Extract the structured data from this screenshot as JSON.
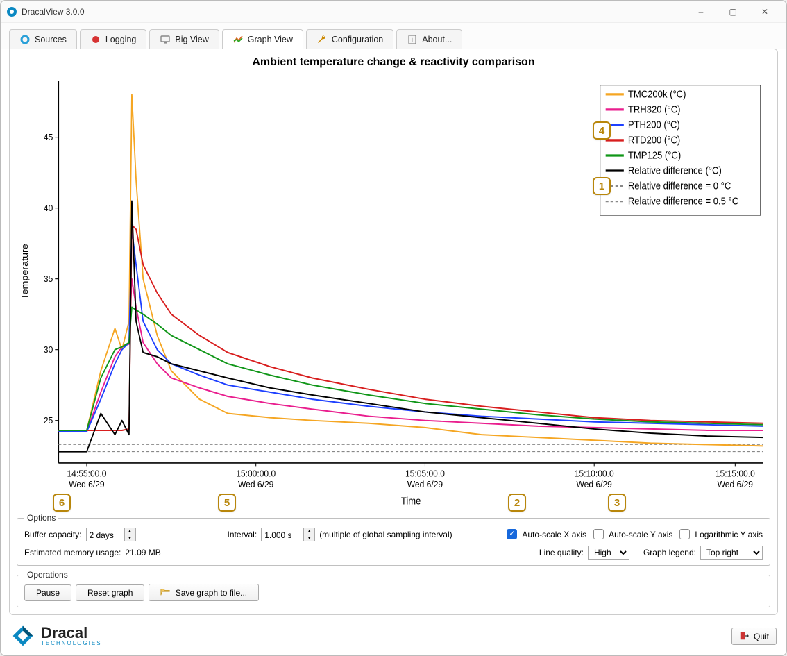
{
  "window": {
    "title": "DracalView 3.0.0"
  },
  "tabs": [
    {
      "label": "Sources"
    },
    {
      "label": "Logging"
    },
    {
      "label": "Big View"
    },
    {
      "label": "Graph View"
    },
    {
      "label": "Configuration"
    },
    {
      "label": "About..."
    }
  ],
  "chart_data": {
    "type": "line",
    "title": "Ambient temperature change & reactivity comparison",
    "xlabel": "Time",
    "ylabel": "Temperature",
    "ylim": [
      22,
      49
    ],
    "categories": [
      "14:55:00.0",
      "15:00:00.0",
      "15:05:00.0",
      "15:10:00.0",
      "15:15:00.0"
    ],
    "x_sublabel": "Wed 6/29",
    "x": [
      0,
      2,
      3,
      4,
      4.5,
      5,
      5.2,
      5.5,
      6,
      7,
      8,
      10,
      12,
      15,
      18,
      22,
      26,
      30,
      34,
      38,
      42,
      46,
      50
    ],
    "series": [
      {
        "name": "TMC200k (°C)",
        "color": "#f5a623",
        "values": [
          24.3,
          24.3,
          28.5,
          31.5,
          30.0,
          32.0,
          48.0,
          42.0,
          35.0,
          31.0,
          28.5,
          26.5,
          25.5,
          25.2,
          25.0,
          24.8,
          24.5,
          24.0,
          23.8,
          23.6,
          23.4,
          23.3,
          23.2
        ]
      },
      {
        "name": "TRH320 (°C)",
        "color": "#e91e8e",
        "values": [
          24.2,
          24.2,
          27.0,
          29.5,
          30.2,
          30.4,
          35.0,
          33.0,
          30.5,
          29.0,
          28.0,
          27.3,
          26.7,
          26.2,
          25.8,
          25.3,
          25.0,
          24.8,
          24.6,
          24.5,
          24.4,
          24.3,
          24.3
        ]
      },
      {
        "name": "PTH200 (°C)",
        "color": "#1e40ff",
        "values": [
          24.2,
          24.2,
          26.5,
          29.0,
          30.0,
          30.5,
          38.5,
          36.0,
          32.0,
          30.0,
          29.0,
          28.2,
          27.5,
          27.0,
          26.5,
          26.0,
          25.6,
          25.3,
          25.1,
          24.9,
          24.8,
          24.7,
          24.6
        ]
      },
      {
        "name": "RTD200 (°C)",
        "color": "#d81e1e",
        "values": [
          24.3,
          24.3,
          24.3,
          24.3,
          24.3,
          24.4,
          38.8,
          38.5,
          36.0,
          34.0,
          32.5,
          31.0,
          29.8,
          28.8,
          28.0,
          27.2,
          26.5,
          26.0,
          25.6,
          25.2,
          25.0,
          24.9,
          24.8
        ]
      },
      {
        "name": "TMP125 (°C)",
        "color": "#109618",
        "values": [
          24.3,
          24.3,
          28,
          30.0,
          30.2,
          30.5,
          33.0,
          32.8,
          32.5,
          31.8,
          31.0,
          30.0,
          29.0,
          28.2,
          27.5,
          26.8,
          26.2,
          25.8,
          25.4,
          25.1,
          24.9,
          24.8,
          24.7
        ]
      },
      {
        "name": "Relative difference (°C)",
        "color": "#000000",
        "values": [
          22.8,
          22.8,
          25.5,
          24.0,
          25.0,
          24.0,
          40.5,
          32.0,
          29.8,
          29.5,
          29.0,
          28.5,
          28.0,
          27.3,
          26.8,
          26.2,
          25.6,
          25.2,
          24.8,
          24.4,
          24.1,
          23.9,
          23.8
        ]
      }
    ],
    "reference_lines": [
      {
        "name": "Relative difference = 0 °C",
        "y": 22.8,
        "style": "dashed"
      },
      {
        "name": "Relative difference = 0.5 °C",
        "y": 23.3,
        "style": "dashed"
      }
    ]
  },
  "options": {
    "group_label": "Options",
    "buffer_label": "Buffer capacity:",
    "buffer_value": "2 days",
    "interval_label": "Interval:",
    "interval_value": "1.000 s",
    "interval_hint": "(multiple of global sampling interval)",
    "autoscale_x_label": "Auto-scale X axis",
    "autoscale_x_checked": true,
    "autoscale_y_label": "Auto-scale Y axis",
    "autoscale_y_checked": false,
    "log_y_label": "Logarithmic Y axis",
    "log_y_checked": false,
    "mem_label": "Estimated memory usage:",
    "mem_value": "21.09 MB",
    "line_quality_label": "Line quality:",
    "line_quality_value": "High",
    "legend_label": "Graph legend:",
    "legend_value": "Top right"
  },
  "operations": {
    "group_label": "Operations",
    "pause": "Pause",
    "reset": "Reset graph",
    "save": "Save graph to file..."
  },
  "footer": {
    "brand": "Dracal",
    "sub": "TECHNOLOGIES",
    "quit": "Quit"
  },
  "callouts": {
    "c1": "1",
    "c2": "2",
    "c3": "3",
    "c4": "4",
    "c5": "5",
    "c6": "6"
  }
}
